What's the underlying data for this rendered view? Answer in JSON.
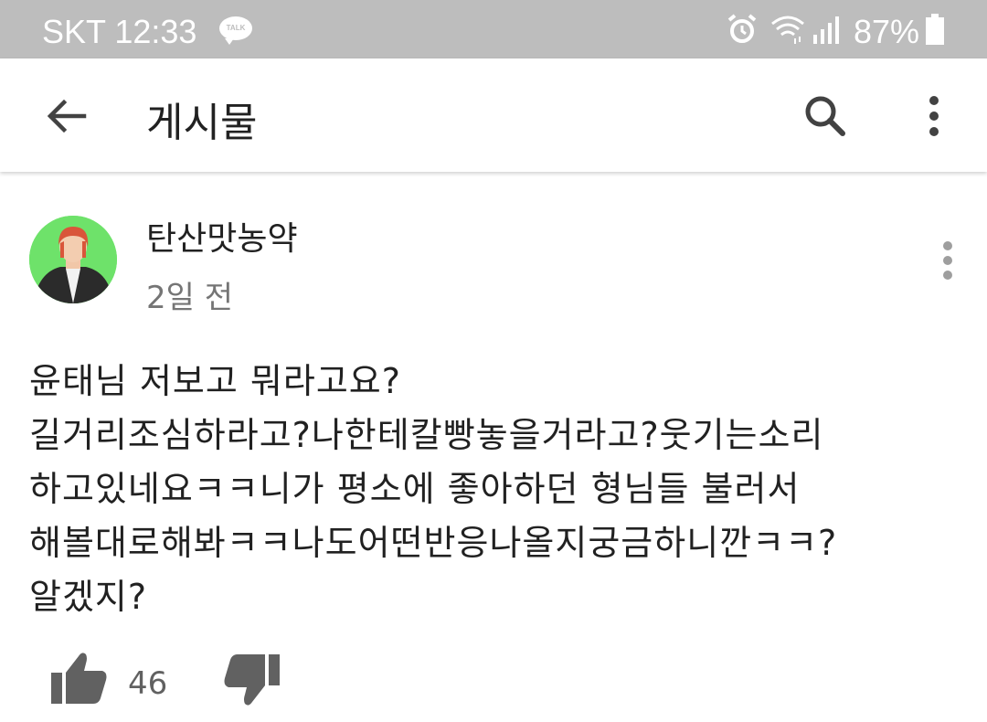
{
  "status_bar": {
    "carrier_time": "SKT 12:33",
    "talk_badge": "TALK",
    "battery_percent": "87%",
    "icons": [
      "kakaotalk-icon",
      "alarm-icon",
      "wifi-icon",
      "signal-icon",
      "battery-icon"
    ]
  },
  "app_bar": {
    "title": "게시물",
    "icons": [
      "back-arrow-icon",
      "search-icon",
      "more-vert-icon"
    ]
  },
  "post": {
    "author": "탄산맛농약",
    "time": "2일 전",
    "body": "윤태님 저보고 뭐라고요?\n길거리조심하라고?나한테칼빵놓을거라고?웃기는소리\n하고있네요ㅋㅋ니가 평소에 좋아하던 형님들 불러서\n해볼대로해봐ㅋㅋ나도어떤반응나올지궁금하니깐ㅋㅋ?\n알겠지?",
    "like_count": "46",
    "icons": [
      "avatar",
      "more-vert-icon",
      "thumb-up-icon",
      "thumb-down-icon"
    ]
  },
  "colors": {
    "status_bar_bg": "#bdbdbd",
    "text_primary": "#212121",
    "text_secondary": "#757575",
    "icon_gray": "#616161",
    "avatar_bg": "#6ee26a"
  }
}
